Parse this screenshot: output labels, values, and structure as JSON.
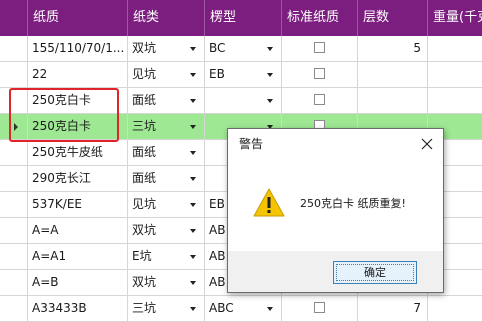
{
  "columns": [
    "纸质",
    "纸类",
    "楞型",
    "标准纸质",
    "层数",
    "重量(千克"
  ],
  "rows": [
    {
      "paper": "155/110/70/1...",
      "kind": "双坑",
      "flute": "BC",
      "std": false,
      "layers": "5",
      "selected": false
    },
    {
      "paper": "22",
      "kind": "见坑",
      "flute": "EB",
      "std": false,
      "layers": "",
      "selected": false
    },
    {
      "paper": "250克白卡",
      "kind": "面纸",
      "flute": "",
      "std": false,
      "layers": "",
      "selected": false
    },
    {
      "paper": "250克白卡",
      "kind": "三坑",
      "flute": "",
      "std": false,
      "layers": "",
      "selected": true
    },
    {
      "paper": "250克牛皮纸",
      "kind": "面纸",
      "flute": "",
      "std": false,
      "layers": "",
      "selected": false
    },
    {
      "paper": "290克长江",
      "kind": "面纸",
      "flute": "",
      "std": false,
      "layers": "",
      "selected": false
    },
    {
      "paper": "537K/EE",
      "kind": "见坑",
      "flute": "EB",
      "std": false,
      "layers": "",
      "selected": false
    },
    {
      "paper": "A=A",
      "kind": "双坑",
      "flute": "AB",
      "std": false,
      "layers": "",
      "selected": false
    },
    {
      "paper": "A=A1",
      "kind": "E坑",
      "flute": "AB",
      "std": false,
      "layers": "",
      "selected": false
    },
    {
      "paper": "A=B",
      "kind": "双坑",
      "flute": "AB",
      "std": false,
      "layers": "",
      "selected": false
    },
    {
      "paper": "A33433B",
      "kind": "三坑",
      "flute": "ABC",
      "std": false,
      "layers": "7",
      "selected": false
    }
  ],
  "dialog": {
    "title": "警告",
    "message": "250克白卡 纸质重复!",
    "ok_label": "确定"
  },
  "colors": {
    "header": "#7b1e7f",
    "selected_row": "#9ee893",
    "highlight_box": "#e0242a",
    "warning": "#f5c400"
  }
}
